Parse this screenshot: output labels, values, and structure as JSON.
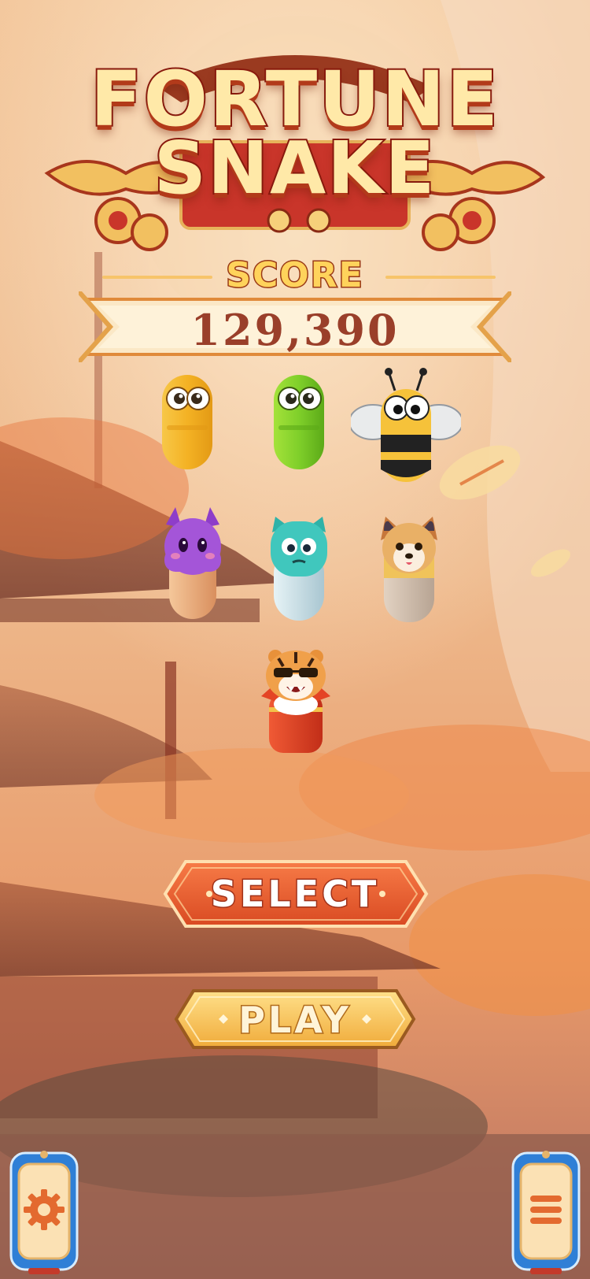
{
  "game": {
    "title_line1": "FORTUNE",
    "title_line2": "SNAKE"
  },
  "score": {
    "label": "SCORE",
    "value": "129,390"
  },
  "characters": [
    {
      "name": "yellow-snake",
      "color": "#f2b632"
    },
    {
      "name": "green-snake",
      "color": "#7fcf2a"
    },
    {
      "name": "bee-snake",
      "color": "#f6c23a"
    },
    {
      "name": "purple-monster",
      "color": "#a455d8"
    },
    {
      "name": "teal-cat",
      "color": "#40c7bd"
    },
    {
      "name": "fox-dog",
      "color": "#e5a23e"
    },
    {
      "name": "tiger",
      "color": "#e44425"
    }
  ],
  "buttons": {
    "select_label": "SELECT",
    "play_label": "PLAY"
  },
  "icons": {
    "settings": "gear-icon",
    "menu": "menu-icon"
  },
  "colors": {
    "title_fill": "#ffe9a8",
    "title_stroke": "#8a1a0e",
    "score_text": "#9a3f2a",
    "select_button": "#e85a2a",
    "play_button": "#f4c65a",
    "corner_frame": "#2f7fd6"
  }
}
